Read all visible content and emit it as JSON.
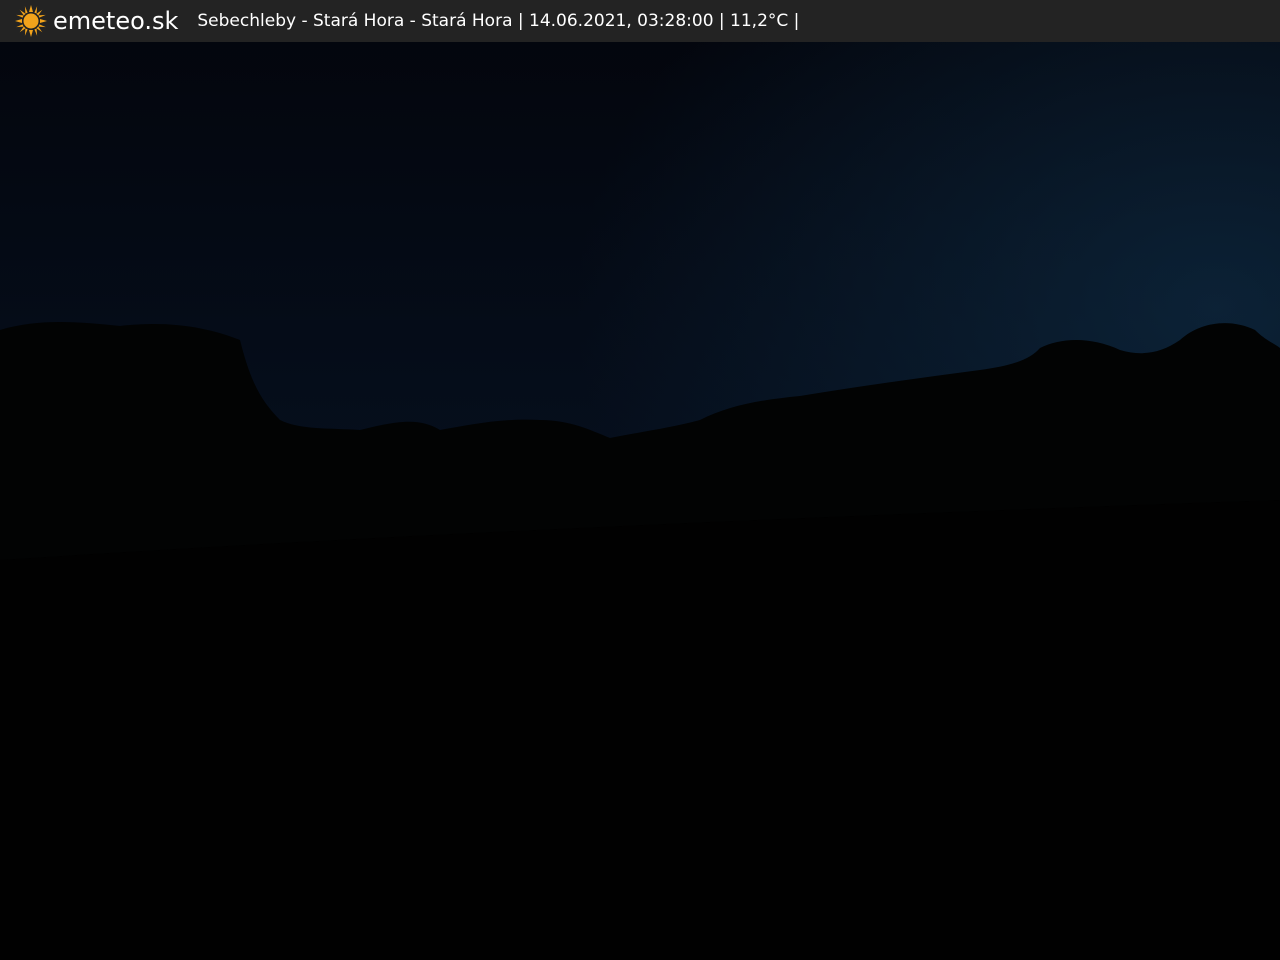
{
  "header": {
    "brand": "emeteo.sk",
    "caption": "Sebechleby - Stará Hora - Stará Hora | 14.06.2021, 03:28:00 | 11,2°C |"
  },
  "icons": {
    "logo": "sun-icon"
  },
  "colors": {
    "bar": "#232323",
    "sun": "#f2a31b",
    "sky_top": "#03050c",
    "sky_horizon": "#0a1a2e"
  }
}
